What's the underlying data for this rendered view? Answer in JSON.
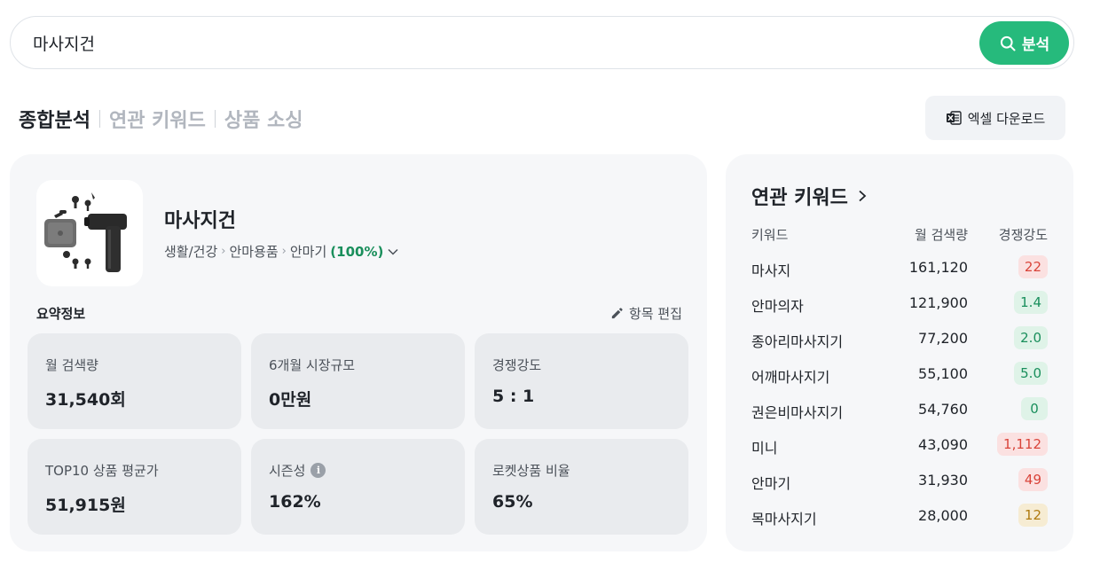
{
  "search": {
    "value": "마사지건",
    "button_label": "분석"
  },
  "tabs": [
    {
      "label": "종합분석",
      "active": true
    },
    {
      "label": "연관 키워드",
      "active": false
    },
    {
      "label": "상품 소싱",
      "active": false
    }
  ],
  "excel_button": {
    "label": "엑셀 다운로드"
  },
  "product": {
    "name": "마사지건",
    "category": [
      "생활/건강",
      "안마용품",
      "안마기"
    ],
    "category_percent": "(100%)"
  },
  "summary": {
    "label": "요약정보",
    "edit_label": "항목 편집",
    "cards": [
      {
        "label": "월 검색량",
        "value": "31,540회"
      },
      {
        "label": "6개월 시장규모",
        "value": "0만원"
      },
      {
        "label": "경쟁강도",
        "value": "5 : 1"
      },
      {
        "label": "TOP10 상품 평균가",
        "value": "51,915원"
      },
      {
        "label": "시즌성",
        "value": "162%"
      },
      {
        "label": "로켓상품 비율",
        "value": "65%"
      }
    ]
  },
  "related": {
    "title": "연관 키워드",
    "headers": {
      "keyword": "키워드",
      "volume": "월 검색량",
      "competition": "경쟁강도"
    },
    "rows": [
      {
        "keyword": "마사지",
        "volume": "161,120",
        "competition": "22",
        "level": "red"
      },
      {
        "keyword": "안마의자",
        "volume": "121,900",
        "competition": "1.4",
        "level": "green"
      },
      {
        "keyword": "종아리마사지기",
        "volume": "77,200",
        "competition": "2.0",
        "level": "green"
      },
      {
        "keyword": "어깨마사지기",
        "volume": "55,100",
        "competition": "5.0",
        "level": "green"
      },
      {
        "keyword": "권은비마사지기",
        "volume": "54,760",
        "competition": "0",
        "level": "green"
      },
      {
        "keyword": "미니",
        "volume": "43,090",
        "competition": "1,112",
        "level": "red"
      },
      {
        "keyword": "안마기",
        "volume": "31,930",
        "competition": "49",
        "level": "red"
      },
      {
        "keyword": "목마사지기",
        "volume": "28,000",
        "competition": "12",
        "level": "yellow"
      }
    ]
  },
  "colors": {
    "accent": "#26ba7c",
    "badge_red": "#d9443a",
    "badge_green": "#1a8f5c",
    "badge_yellow": "#b07b0f"
  }
}
